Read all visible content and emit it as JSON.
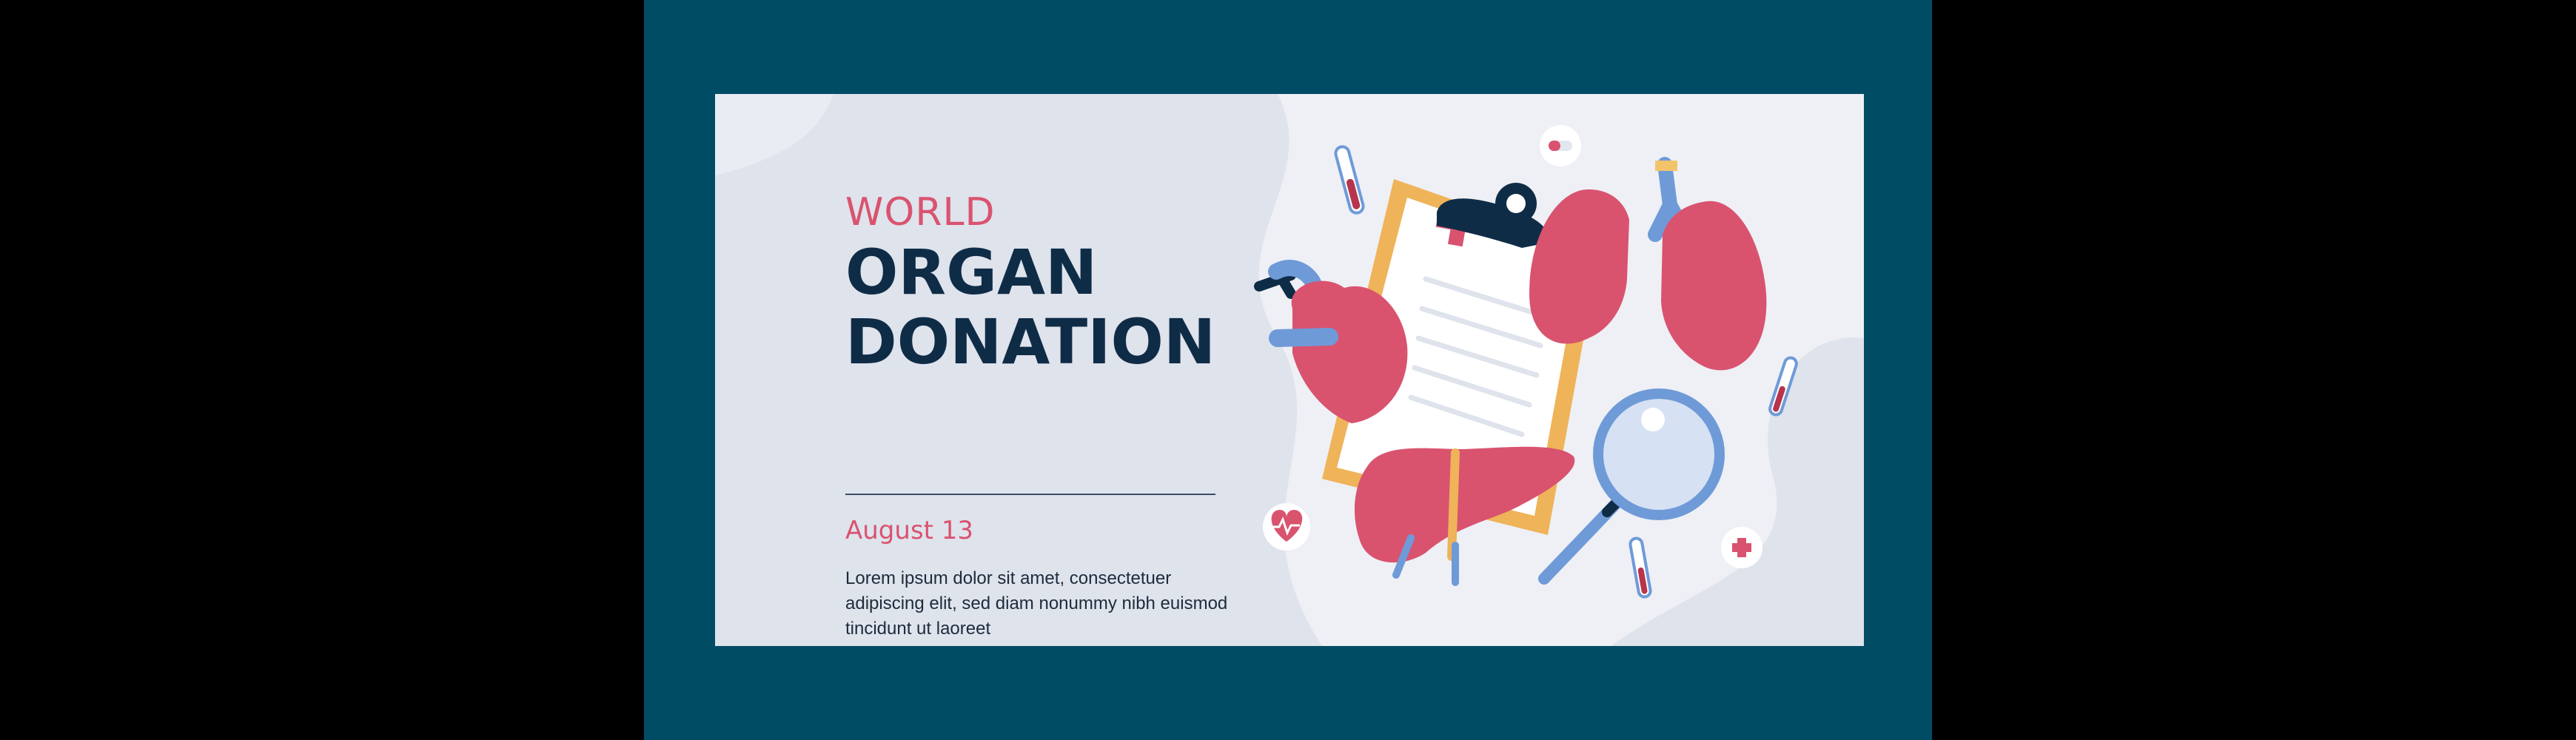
{
  "banner": {
    "kicker": "WORLD",
    "title": "ORGAN DONATION",
    "date": "August 13",
    "body": "Lorem ipsum dolor sit amet, consectetuer adipiscing elit, sed diam nonummy nibh euismod tincidunt ut laoreet"
  },
  "colors": {
    "frame": "#004c65",
    "card": "#eef0f5",
    "accent_pink": "#d9536f",
    "navy": "#0f2c47",
    "organ": "#d9536f",
    "clipboard": "#efb35a",
    "blue": "#6f9ad8"
  },
  "icons": [
    "clipboard-icon",
    "lungs-icon",
    "heart-icon",
    "liver-icon",
    "magnifier-icon",
    "test-tube-icon",
    "pill-icon",
    "cardiogram-icon",
    "medical-cross-icon"
  ]
}
